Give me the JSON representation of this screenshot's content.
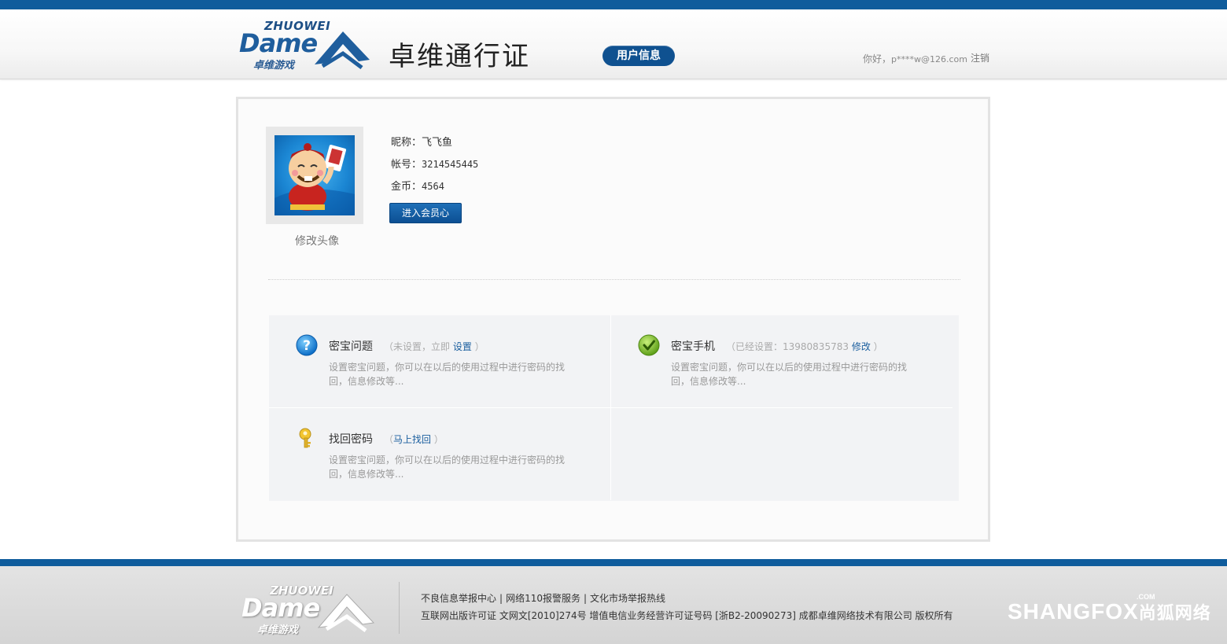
{
  "header": {
    "logo": {
      "en_top": "ZHUOWEI",
      "en_main": "Dame",
      "cn": "卓维游戏"
    },
    "site_title": "卓维通行证",
    "active_tab": "用户信息",
    "greeting_label": "你好，",
    "user_email": "p****w@126.com",
    "logout": "注销"
  },
  "profile": {
    "change_avatar": "修改头像",
    "nickname_label": "昵称：",
    "nickname": "飞飞鱼",
    "account_label": "帐号：",
    "account": "3214545445",
    "coins_label": "金币：",
    "coins": "4564",
    "member_button": "进入会员心"
  },
  "security": {
    "question": {
      "title": "密宝问题",
      "note_prefix": "（未设置，立即",
      "action": "设置",
      "note_suffix": "）",
      "desc": "设置密宝问题，你可以在以后的使用过程中进行密码的找回，信息修改等..."
    },
    "phone": {
      "title": "密宝手机",
      "note_prefix": "（已经设置：13980835783",
      "action": "修改",
      "note_suffix": "）",
      "desc": "设置密宝问题，你可以在以后的使用过程中进行密码的找回，信息修改等..."
    },
    "recover": {
      "title": "找回密码",
      "note_prefix": "（",
      "action": "马上找回",
      "note_suffix": "）",
      "desc": "设置密宝问题，你可以在以后的使用过程中进行密码的找回，信息修改等..."
    }
  },
  "footer": {
    "links": [
      "不良信息举报中心",
      "网络110报警服务",
      "文化市场举报热线"
    ],
    "separator": "|",
    "license": "互联网出版许可证 文网文[2010]274号 增值电信业务经营许可证号码 [浙B2-20090273] 成都卓维网络技术有限公司 版权所有",
    "partner": {
      "en": "SHANGFOX",
      "cn": "尚狐网络",
      "com": ".COM"
    }
  },
  "colors": {
    "brand_blue": "#0f5c9c",
    "link_blue": "#1a5e9e",
    "panel_bg": "#fbfbfb"
  }
}
